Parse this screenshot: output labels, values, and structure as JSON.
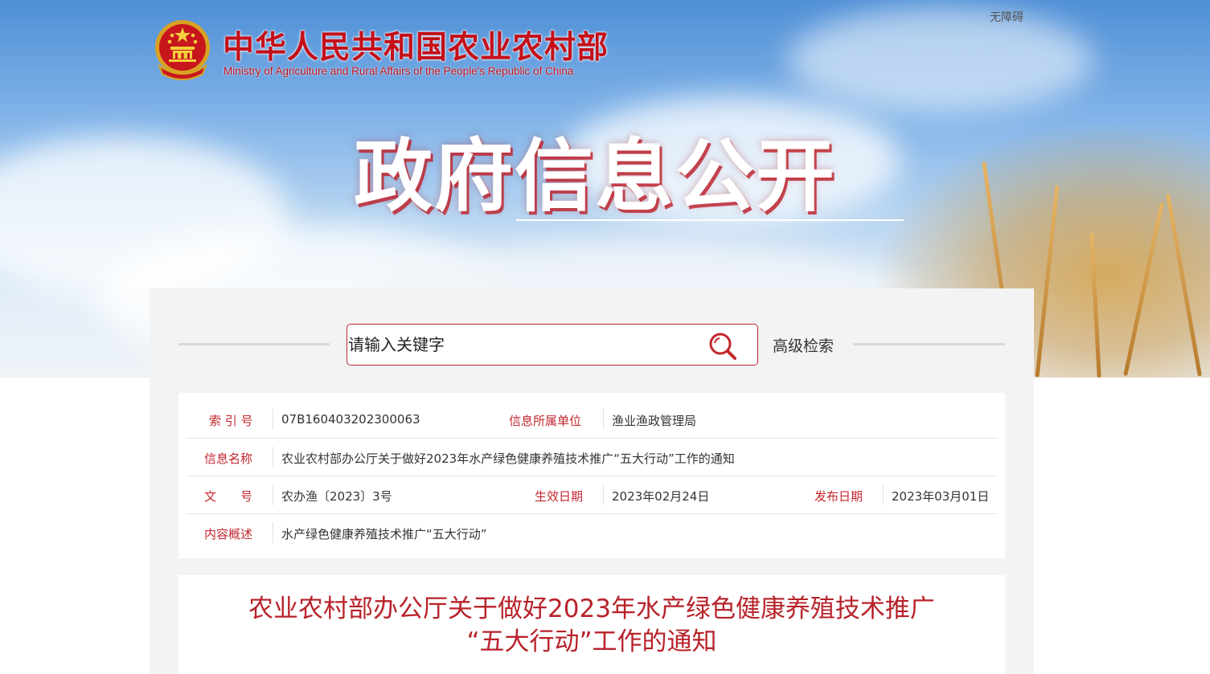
{
  "header": {
    "ministry_cn": "中华人民共和国农业农村部",
    "ministry_en": "Ministry of Agriculture and Rural Affairs of the People's Republic of China",
    "accessibility": "无障碍",
    "hero_title": "政府信息公开",
    "brand_color": "#c4101a"
  },
  "search": {
    "placeholder": "请输入关键字",
    "advanced_label": "高级检索"
  },
  "meta": {
    "index_label": "索 引 号",
    "index_value": "07B160403202300063",
    "unit_label": "信息所属单位",
    "unit_value": "渔业渔政管理局",
    "name_label": "信息名称",
    "name_value": "农业农村部办公厅关于做好2023年水产绿色健康养殖技术推广“五大行动”工作的通知",
    "docno_label": "文　　号",
    "docno_value": "农办渔〔2023〕3号",
    "effective_label": "生效日期",
    "effective_value": "2023年02月24日",
    "publish_label": "发布日期",
    "publish_value": "2023年03月01日",
    "summary_label": "内容概述",
    "summary_value": "水产绿色健康养殖技术推广“五大行动”"
  },
  "article": {
    "title_line1": "农业农村部办公厅关于做好2023年水产绿色健康养殖技术推广",
    "title_line2": "“五大行动”工作的通知"
  }
}
